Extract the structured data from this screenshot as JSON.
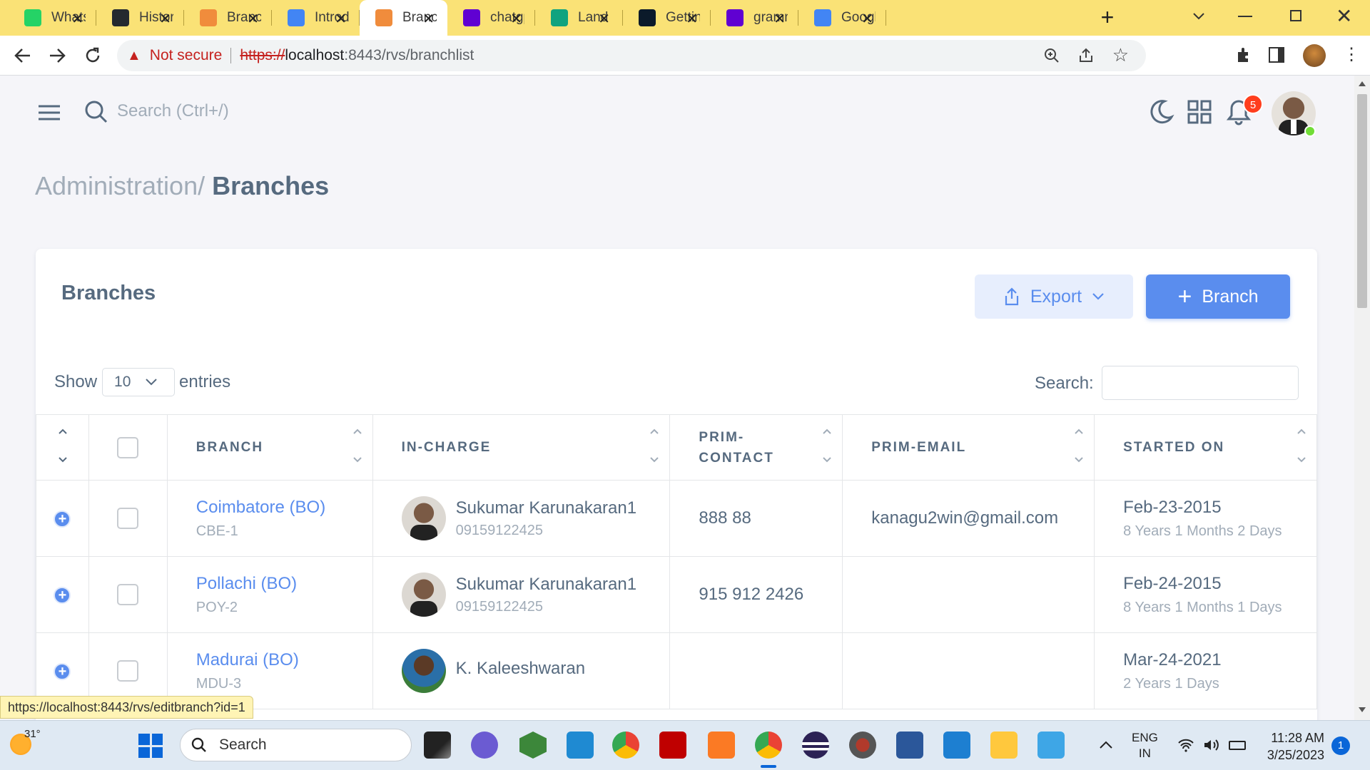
{
  "browser": {
    "tabs": [
      {
        "title": "WhatsApp",
        "icon": "whatsapp-icon",
        "color": "#25d366"
      },
      {
        "title": "History",
        "icon": "github-icon",
        "color": "#24292f"
      },
      {
        "title": "Branches",
        "icon": "orange-logo-icon",
        "color": "#f08c3c"
      },
      {
        "title": "Introduction",
        "icon": "loading-icon",
        "color": "#4285f4"
      },
      {
        "title": "Branches",
        "icon": "orange-logo-icon",
        "color": "#f08c3c",
        "active": true
      },
      {
        "title": "chatgpt",
        "icon": "yahoo-icon",
        "color": "#6001d2"
      },
      {
        "title": "Land S",
        "icon": "openai-icon",
        "color": "#10a37f"
      },
      {
        "title": "Getting",
        "icon": "react-icon",
        "color": "#0b1a2a"
      },
      {
        "title": "grammar",
        "icon": "yahoo-icon",
        "color": "#6001d2"
      },
      {
        "title": "Google",
        "icon": "google-translate-icon",
        "color": "#4285f4"
      }
    ],
    "not_secure": "Not secure",
    "url_scheme": "https://",
    "url_host": "localhost",
    "url_rest": ":8443/rvs/branchlist",
    "status_url": "https://localhost:8443/rvs/editbranch?id=1"
  },
  "topbar": {
    "search_placeholder": "Search (Ctrl+/)",
    "notification_count": "5"
  },
  "breadcrumb": {
    "parent": "Administration/",
    "current": "Branches"
  },
  "card": {
    "title": "Branches",
    "export_label": "Export",
    "add_label": "Branch",
    "show_label": "Show",
    "entries_count": "10",
    "entries_label": "entries",
    "search_label": "Search:"
  },
  "table": {
    "columns": [
      "BRANCH",
      "IN-CHARGE",
      "PRIM-CONTACT",
      "PRIM-EMAIL",
      "STARTED ON"
    ],
    "col_contact_l1": "PRIM-",
    "col_contact_l2": "CONTACT",
    "rows": [
      {
        "branch": "Coimbatore (BO)",
        "code": "CBE-1",
        "incharge": "Sukumar Karunakaran1",
        "incharge_phone": "09159122425",
        "contact": "888 88",
        "email": "kanagu2win@gmail.com",
        "started": "Feb-23-2015",
        "duration": "8 Years 1 Months 2 Days"
      },
      {
        "branch": "Pollachi (BO)",
        "code": "POY-2",
        "incharge": "Sukumar Karunakaran1",
        "incharge_phone": "09159122425",
        "contact": "915 912 2426",
        "email": "",
        "started": "Feb-24-2015",
        "duration": "8 Years 1 Months 1 Days"
      },
      {
        "branch": "Madurai (BO)",
        "code": "MDU-3",
        "incharge": "K. Kaleeshwaran",
        "incharge_phone": "",
        "contact": "",
        "email": "",
        "started": "Mar-24-2021",
        "duration": "2 Years 1 Days"
      }
    ]
  },
  "taskbar": {
    "weather": "31°",
    "search_label": "Search",
    "lang_1": "ENG",
    "lang_2": "IN",
    "time": "11:28 AM",
    "date": "3/25/2023",
    "notif": "1"
  },
  "colors": {
    "primary": "#5a8dee",
    "link": "#5a8dee",
    "tabstrip": "#fae276",
    "danger": "#ff3e1d"
  }
}
